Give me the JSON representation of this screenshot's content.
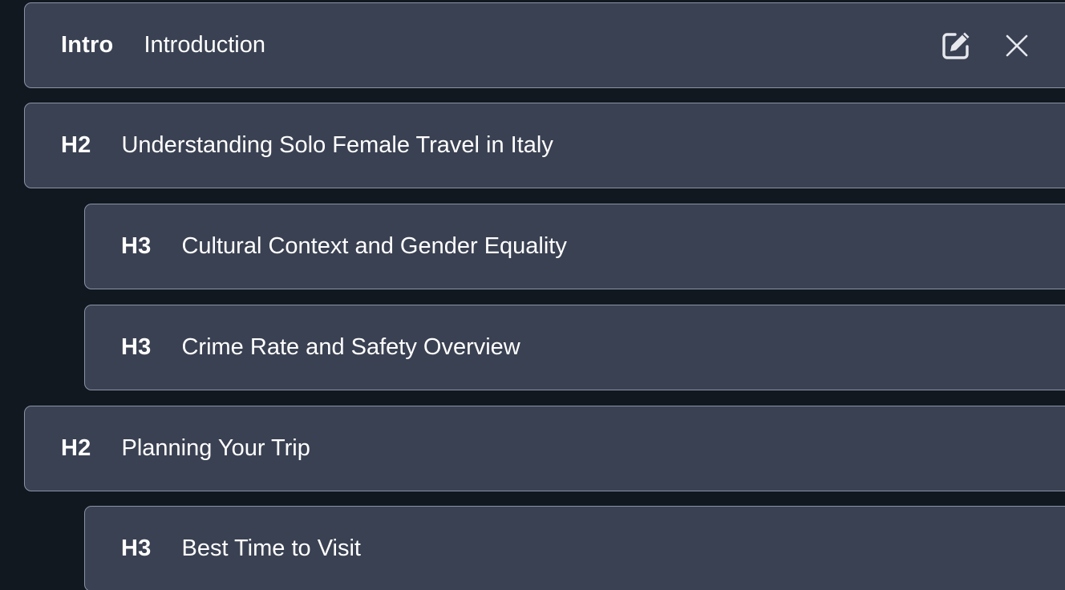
{
  "outline": {
    "intro": {
      "tag": "Intro",
      "title": "Introduction",
      "edit_icon": "edit-icon",
      "close_icon": "close-icon"
    },
    "items": [
      {
        "tag": "H2",
        "title": "Understanding Solo Female Travel in Italy",
        "level": 2
      },
      {
        "tag": "H3",
        "title": "Cultural Context and Gender Equality",
        "level": 3
      },
      {
        "tag": "H3",
        "title": "Crime Rate and Safety Overview",
        "level": 3
      },
      {
        "tag": "H2",
        "title": "Planning Your Trip",
        "level": 2
      },
      {
        "tag": "H3",
        "title": "Best Time to Visit",
        "level": 3
      }
    ]
  },
  "colors": {
    "background": "#111820",
    "row_fill": "#3a4152",
    "row_border": "#8a93a6",
    "text": "#ffffff",
    "accent": "#c05ad8"
  }
}
